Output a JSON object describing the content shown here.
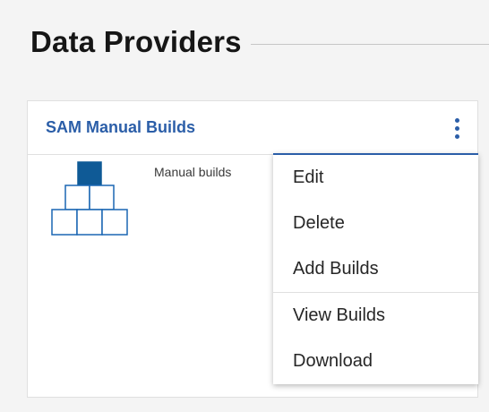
{
  "section": {
    "title": "Data Providers"
  },
  "card": {
    "title": "SAM Manual Builds",
    "description": "Manual builds",
    "icon": "pyramid-blocks-icon"
  },
  "menu": {
    "items": [
      {
        "label": "Edit"
      },
      {
        "label": "Delete"
      },
      {
        "label": "Add Builds"
      },
      {
        "label": "View Builds"
      },
      {
        "label": "Download"
      }
    ]
  },
  "colors": {
    "accent": "#2b5ea8",
    "icon_fill": "#0f5a96",
    "icon_stroke": "#1a66b3"
  }
}
